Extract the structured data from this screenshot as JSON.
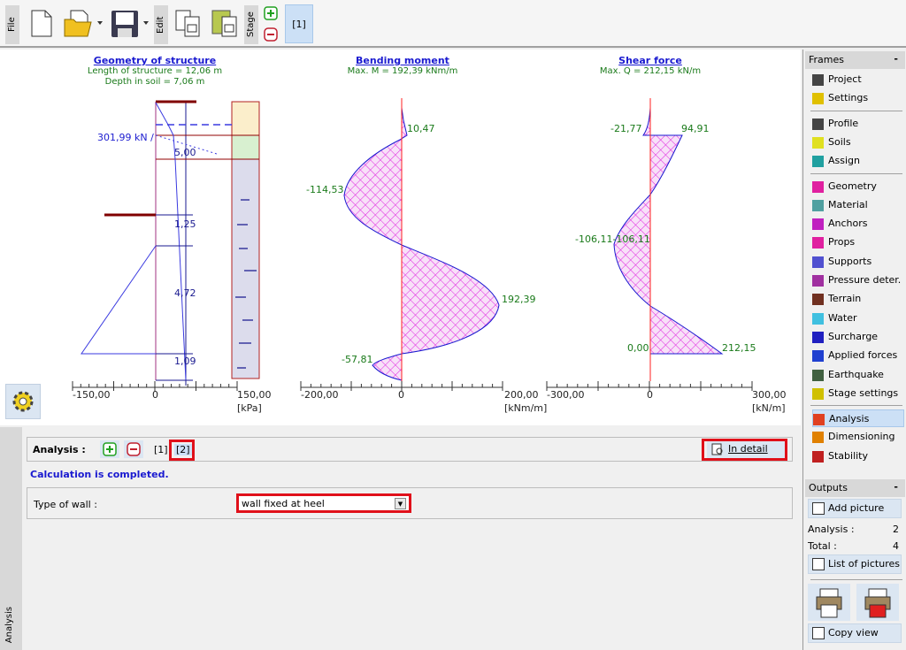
{
  "toolbar": {
    "file": "File",
    "edit": "Edit",
    "stage": "Stage",
    "stage_tab": "[1]",
    "icons": [
      "new-file-icon",
      "open-folder-icon",
      "save-icon",
      "copy-icon",
      "paste-icon",
      "add-stage-icon",
      "remove-stage-icon"
    ]
  },
  "geometry": {
    "title": "Geometry of structure",
    "length": "Length of structure = 12,06 m",
    "depth": "Depth in soil = 7,06 m",
    "force": "301,99 kN /",
    "dims": [
      "5,00",
      "1,25",
      "4,72",
      "1,09"
    ],
    "axis": {
      "min": "-150,00",
      "zero": "0",
      "max": "150,00",
      "unit": "[kPa]"
    }
  },
  "moment": {
    "title": "Bending moment",
    "max": "Max. M = 192,39 kNm/m",
    "labels": [
      "10,47",
      "-114,53",
      "192,39",
      "-57,81"
    ],
    "axis": {
      "min": "-200,00",
      "zero": "0",
      "max": "200,00",
      "unit": "[kNm/m]"
    }
  },
  "shear": {
    "title": "Shear force",
    "max": "Max. Q = 212,15 kN/m",
    "labels": [
      "-21,77",
      "94,91",
      "-106,11-106,11",
      "0,00",
      "212,15"
    ],
    "axis": {
      "min": "-300,00",
      "zero": "0",
      "max": "300,00",
      "unit": "[kN/m]"
    }
  },
  "colors": {
    "hatch": "#e020e0",
    "outline": "#1a1ad0",
    "zero_line": "#ff2020",
    "value_label": "#1a7a1a",
    "highlight": "#e0101a"
  },
  "bottom": {
    "strip": "Analysis",
    "analysis_label": "Analysis :",
    "tabs": [
      "[1]",
      "[2]"
    ],
    "in_detail": "In detail",
    "status": "Calculation is completed.",
    "type_of_wall_label": "Type of wall  :",
    "type_of_wall_value": "wall fixed at heel"
  },
  "frames": {
    "title": "Frames",
    "items": [
      "Project",
      "Settings",
      "Profile",
      "Soils",
      "Assign",
      "Geometry",
      "Material",
      "Anchors",
      "Props",
      "Supports",
      "Pressure deter.",
      "Terrain",
      "Water",
      "Surcharge",
      "Applied forces",
      "Earthquake",
      "Stage settings",
      "Analysis",
      "Dimensioning",
      "Stability"
    ],
    "active": "Analysis"
  },
  "outputs": {
    "title": "Outputs",
    "add_picture": "Add picture",
    "analysis_label": "Analysis :",
    "analysis_count": "2",
    "total_label": "Total :",
    "total_count": "4",
    "list_pictures": "List of pictures",
    "copy_view": "Copy view"
  }
}
